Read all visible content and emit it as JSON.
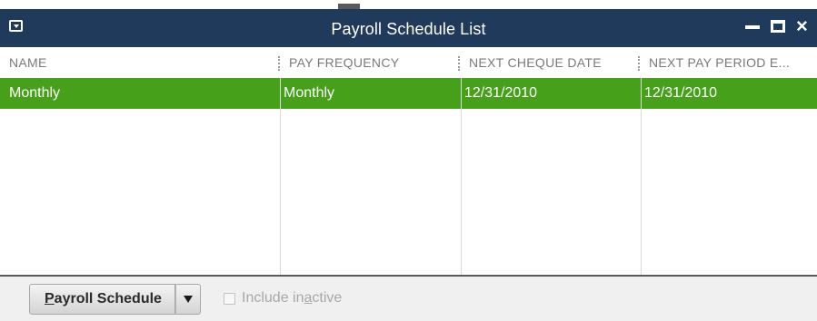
{
  "window": {
    "title": "Payroll Schedule List"
  },
  "icons": {
    "system_menu": "system-menu-icon",
    "minimize": "minimize-icon",
    "maximize": "maximize-icon",
    "close": "close-icon",
    "dropdown": "dropdown-arrow-icon"
  },
  "columns": [
    {
      "label": "NAME"
    },
    {
      "label": "PAY FREQUENCY"
    },
    {
      "label": "NEXT CHEQUE DATE"
    },
    {
      "label": "NEXT PAY PERIOD E..."
    }
  ],
  "rows": [
    {
      "name": "Monthly",
      "pay_frequency": "Monthly",
      "next_cheque_date": "12/31/2010",
      "next_pay_period_end": "12/31/2010",
      "selected": true
    }
  ],
  "footer": {
    "main_button_label_underlined": "P",
    "main_button_label_rest": "ayroll Schedule",
    "include_inactive_pre": "Include in",
    "include_inactive_ul": "a",
    "include_inactive_post": "ctive",
    "include_inactive_checked": false
  },
  "colors": {
    "titlebar": "#1f3a5a",
    "selected_row": "#46a01a"
  }
}
